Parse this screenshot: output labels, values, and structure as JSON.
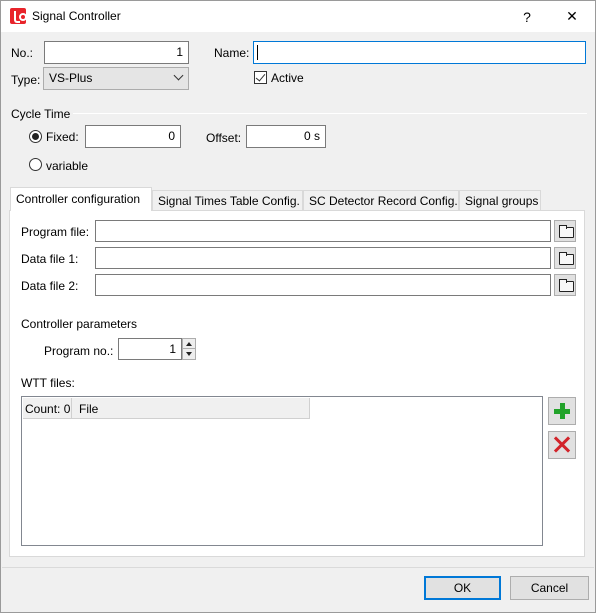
{
  "window": {
    "title": "Signal Controller",
    "help_label": "?",
    "close_label": "✕"
  },
  "general": {
    "no_label": "No.:",
    "no_value": "1",
    "name_label": "Name:",
    "name_value": "",
    "type_label": "Type:",
    "type_value": "VS-Plus",
    "active_label": "Active",
    "active_checked": true
  },
  "cycle_time": {
    "section_label": "Cycle Time",
    "fixed_label": "Fixed:",
    "fixed_value": "0",
    "fixed_selected": true,
    "offset_label": "Offset:",
    "offset_value": "0 s",
    "variable_label": "variable"
  },
  "tabs": [
    {
      "label": "Controller configuration",
      "active": true
    },
    {
      "label": "Signal Times Table Config.",
      "active": false
    },
    {
      "label": "SC Detector Record Config.",
      "active": false
    },
    {
      "label": "Signal groups",
      "active": false
    }
  ],
  "controller_config": {
    "program_file_label": "Program file:",
    "program_file_value": "",
    "data_file1_label": "Data file 1:",
    "data_file1_value": "",
    "data_file2_label": "Data file 2:",
    "data_file2_value": "",
    "params_section_label": "Controller parameters",
    "program_no_label": "Program no.:",
    "program_no_value": "1",
    "wtt_label": "WTT files:",
    "wtt_columns": [
      "Count: 0",
      "File"
    ]
  },
  "icons": {
    "app": "signal-controller-app-icon",
    "browse": "folder-open-icon",
    "add": "green-plus-icon",
    "delete": "red-x-icon"
  },
  "colors": {
    "accent": "#0078d7",
    "add_green": "#22a32a",
    "delete_red": "#d2232a",
    "app_red": "#e8242b"
  },
  "footer": {
    "ok_label": "OK",
    "cancel_label": "Cancel"
  }
}
